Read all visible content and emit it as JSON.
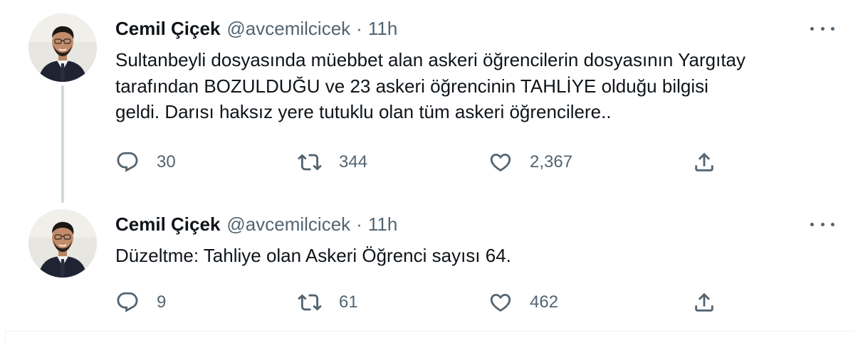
{
  "tweets": [
    {
      "author_name": "Cemil Çiçek",
      "handle": "@avcemilcicek",
      "separator": "·",
      "time": "11h",
      "text": "Sultanbeyli dosyasında müebbet alan askeri öğrencilerin dosyasının Yargıtay\ntarafından BOZULDUĞU ve 23 askeri öğrencinin TAHLİYE olduğu bilgisi\ngeldi. Darısı haksız yere tutuklu olan tüm askeri öğrencilere..",
      "replies": "30",
      "retweets": "344",
      "likes": "2,367",
      "icons": {
        "reply": "reply-icon",
        "retweet": "retweet-icon",
        "like": "heart-icon",
        "share": "share-icon",
        "more": "more-icon"
      }
    },
    {
      "author_name": "Cemil Çiçek",
      "handle": "@avcemilcicek",
      "separator": "·",
      "time": "11h",
      "text": "Düzeltme: Tahliye olan Askeri Öğrenci sayısı 64.",
      "replies": "9",
      "retweets": "61",
      "likes": "462",
      "icons": {
        "reply": "reply-icon",
        "retweet": "retweet-icon",
        "like": "heart-icon",
        "share": "share-icon",
        "more": "more-icon"
      }
    }
  ],
  "colors": {
    "text": "#0f1419",
    "secondary": "#536471",
    "thread_line": "#cfd9de",
    "border": "#eff3f4",
    "background": "#ffffff"
  }
}
